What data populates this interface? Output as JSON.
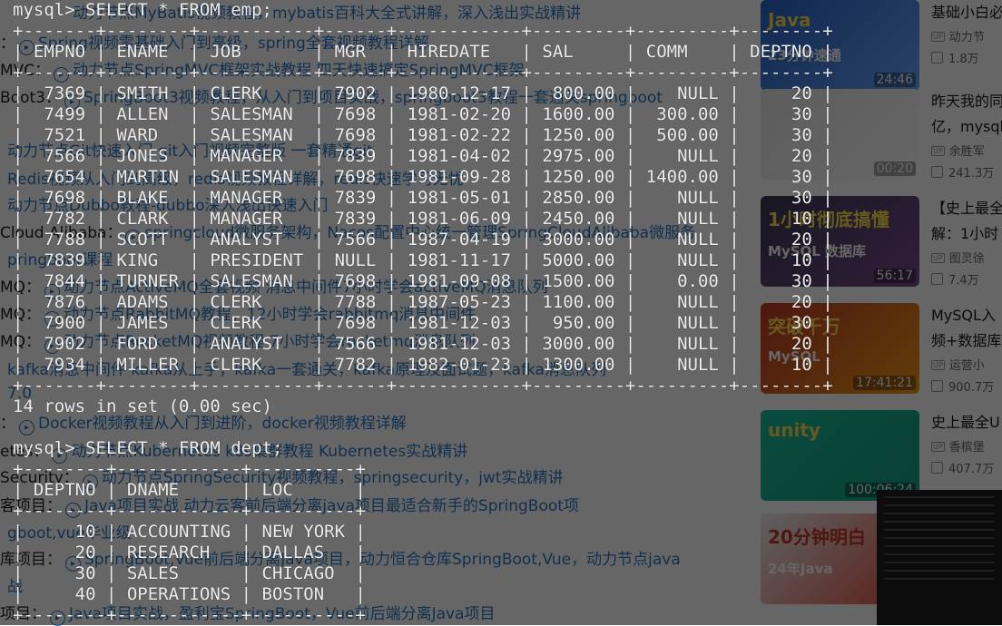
{
  "terminal": {
    "lines": [
      "mysql> SELECT * FROM emp;",
      "+-------+--------+-----------+------+------------+---------+---------+--------+",
      "| EMPNO | ENAME  | JOB       | MGR  | HIREDATE   | SAL     | COMM    | DEPTNO |",
      "+-------+--------+-----------+------+------------+---------+---------+--------+",
      "|  7369 | SMITH  | CLERK     | 7902 | 1980-12-17 |  800.00 |    NULL |     20 |",
      "|  7499 | ALLEN  | SALESMAN  | 7698 | 1981-02-20 | 1600.00 |  300.00 |     30 |",
      "|  7521 | WARD   | SALESMAN  | 7698 | 1981-02-22 | 1250.00 |  500.00 |     30 |",
      "|  7566 | JONES  | MANAGER   | 7839 | 1981-04-02 | 2975.00 |    NULL |     20 |",
      "|  7654 | MARTIN | SALESMAN  | 7698 | 1981-09-28 | 1250.00 | 1400.00 |     30 |",
      "|  7698 | BLAKE  | MANAGER   | 7839 | 1981-05-01 | 2850.00 |    NULL |     30 |",
      "|  7782 | CLARK  | MANAGER   | 7839 | 1981-06-09 | 2450.00 |    NULL |     10 |",
      "|  7788 | SCOTT  | ANALYST   | 7566 | 1987-04-19 | 3000.00 |    NULL |     20 |",
      "|  7839 | KING   | PRESIDENT | NULL | 1981-11-17 | 5000.00 |    NULL |     10 |",
      "|  7844 | TURNER | SALESMAN  | 7698 | 1981-09-08 | 1500.00 |    0.00 |     30 |",
      "|  7876 | ADAMS  | CLERK     | 7788 | 1987-05-23 | 1100.00 |    NULL |     20 |",
      "|  7900 | JAMES  | CLERK     | 7698 | 1981-12-03 |  950.00 |    NULL |     30 |",
      "|  7902 | FORD   | ANALYST   | 7566 | 1981-12-03 | 3000.00 |    NULL |     20 |",
      "|  7934 | MILLER | CLERK     | 7782 | 1982-01-23 | 1300.00 |    NULL |     10 |",
      "+-------+--------+-----------+------+------------+---------+---------+--------+",
      "14 rows in set (0.00 sec)",
      "",
      "mysql> SELECT * FROM dept;",
      "+--------+------------+----------+",
      "| DEPTNO | DNAME      | LOC      |",
      "+--------+------------+----------+",
      "|     10 | ACCOUNTING | NEW YORK |",
      "|     20 | RESEARCH   | DALLAS   |",
      "|     30 | SALES      | CHICAGO  |",
      "|     40 | OPERATIONS | BOSTON   |",
      "+--------+------------+----------+"
    ]
  },
  "background": {
    "lines": [
      {
        "prefix": "",
        "text": "动力节点MyBatis视频教程，mybatis百科大全式讲解，深入浅出实战精讲"
      },
      {
        "prefix": "：",
        "text": "Spring视频零基础入门到高级，spring全套视频教程详解"
      },
      {
        "prefix": "MVC：",
        "text": "动力节点SpringMVC框架实战教程 四天快速搞定SpringMVC框架"
      },
      {
        "prefix": "Boot3：",
        "text": "SpringBoot3视频教程，从入门到项目实战，springboot3教程一套通关springboot"
      },
      {
        "prefix": "",
        "text": "动力节点Git快速入门 git入门视频完整版 一套精通git"
      },
      {
        "prefix": "",
        "text": "Redis视频从入门到高级，redis视频教程详解，redis快速学习无忧"
      },
      {
        "prefix": "",
        "text": "动力节点Dubbo教程-dubbo深入浅出快速入门"
      },
      {
        "prefix": "Cloud Alibaba：",
        "text": "springcloud微服务架构，Nacos配置中心统一管理SpringCloudAlibaba微服务"
      },
      {
        "prefix": "",
        "text": "pringboot课程"
      },
      {
        "prefix": "MQ：",
        "text": "动力节点ActiveMQ全套视频 消息中间件7小时学会activeMQ消息队列"
      },
      {
        "prefix": "MQ：",
        "text": "动力节点RabbitMQ教程，12小时学会rabbitmq消息中间件"
      },
      {
        "prefix": "MQ：",
        "text": "动力节点RocketMQ视频教程 7小时学会rocketmq消息队列"
      },
      {
        "prefix": "",
        "text": "kafka消息中间件 kafka从上手，kafka一套通关，kafka原理及面试题，kafka消息队列"
      },
      {
        "prefix": "",
        "text": "7.0"
      },
      {
        "prefix": "：",
        "text": "Docker视频教程从入门到进阶，docker视频教程详解"
      },
      {
        "prefix": "etes：",
        "text": "动力节点Kubernetes k8s集群教程 Kubernetes实战精讲"
      },
      {
        "prefix": "Security：",
        "text": "动力节点SpringSecurity视频教程，springsecurity，jwt实战精讲"
      },
      {
        "prefix": "客项目：",
        "text": "Java项目实战 动力云客前后端分离java项目最适合新手的SpringBoot项"
      },
      {
        "prefix": "",
        "text": "gboot,vue毕业级"
      },
      {
        "prefix": "库项目：",
        "text": "SpringBoot,Vue前后端分离Java项目，动力恒合仓库SpringBoot,Vue，动力节点java"
      },
      {
        "prefix": "",
        "text": "战"
      },
      {
        "prefix": "项目：",
        "text": "Java项目实战，盈利宝SpringBoot，Vue前后端分离Java项目"
      }
    ],
    "videos": [
      {
        "thumb_text": "Java",
        "badge": "23分钟速通",
        "duration": "24:46",
        "title": "基础小白必",
        "uploader": "动力节",
        "plays": "1.8万",
        "colors": [
          "#2a63c9",
          "#6aa7ff"
        ]
      },
      {
        "thumb_text": "",
        "badge": "",
        "duration": "00:20",
        "title": "昨天我的同",
        "title2": "亿，mysql",
        "uploader": "余胜军",
        "plays": "241.3万",
        "colors": [
          "#e8e8e8",
          "#ffffff"
        ]
      },
      {
        "thumb_text": "1小时彻底搞懂",
        "badge": "MySQL 数据库",
        "duration": "56:17",
        "title": "【史上最全",
        "title2": "解：1小时",
        "uploader": "图灵徐",
        "plays": "7.4万",
        "colors": [
          "#3b3b55",
          "#7a4b8f"
        ]
      },
      {
        "thumb_text": "突破千万",
        "badge": "MySQL",
        "duration": "17:41:21",
        "title": "MySQL入",
        "title2": "频+数据库",
        "uploader": "运营小",
        "plays": "900.7万",
        "colors": [
          "#c0392b",
          "#f39c12"
        ]
      },
      {
        "thumb_text": "unity",
        "badge": "",
        "duration": "100:06:24",
        "title": "史上最全U",
        "uploader": "香槟堡",
        "plays": "407.7万",
        "colors": [
          "#1abc9c",
          "#16a085"
        ]
      },
      {
        "thumb_text": "20分钟明白",
        "badge": "24年Java",
        "duration": "",
        "title": "",
        "uploader": "",
        "plays": "",
        "colors": [
          "#ecf0f1",
          "#e74c3c"
        ]
      }
    ]
  }
}
